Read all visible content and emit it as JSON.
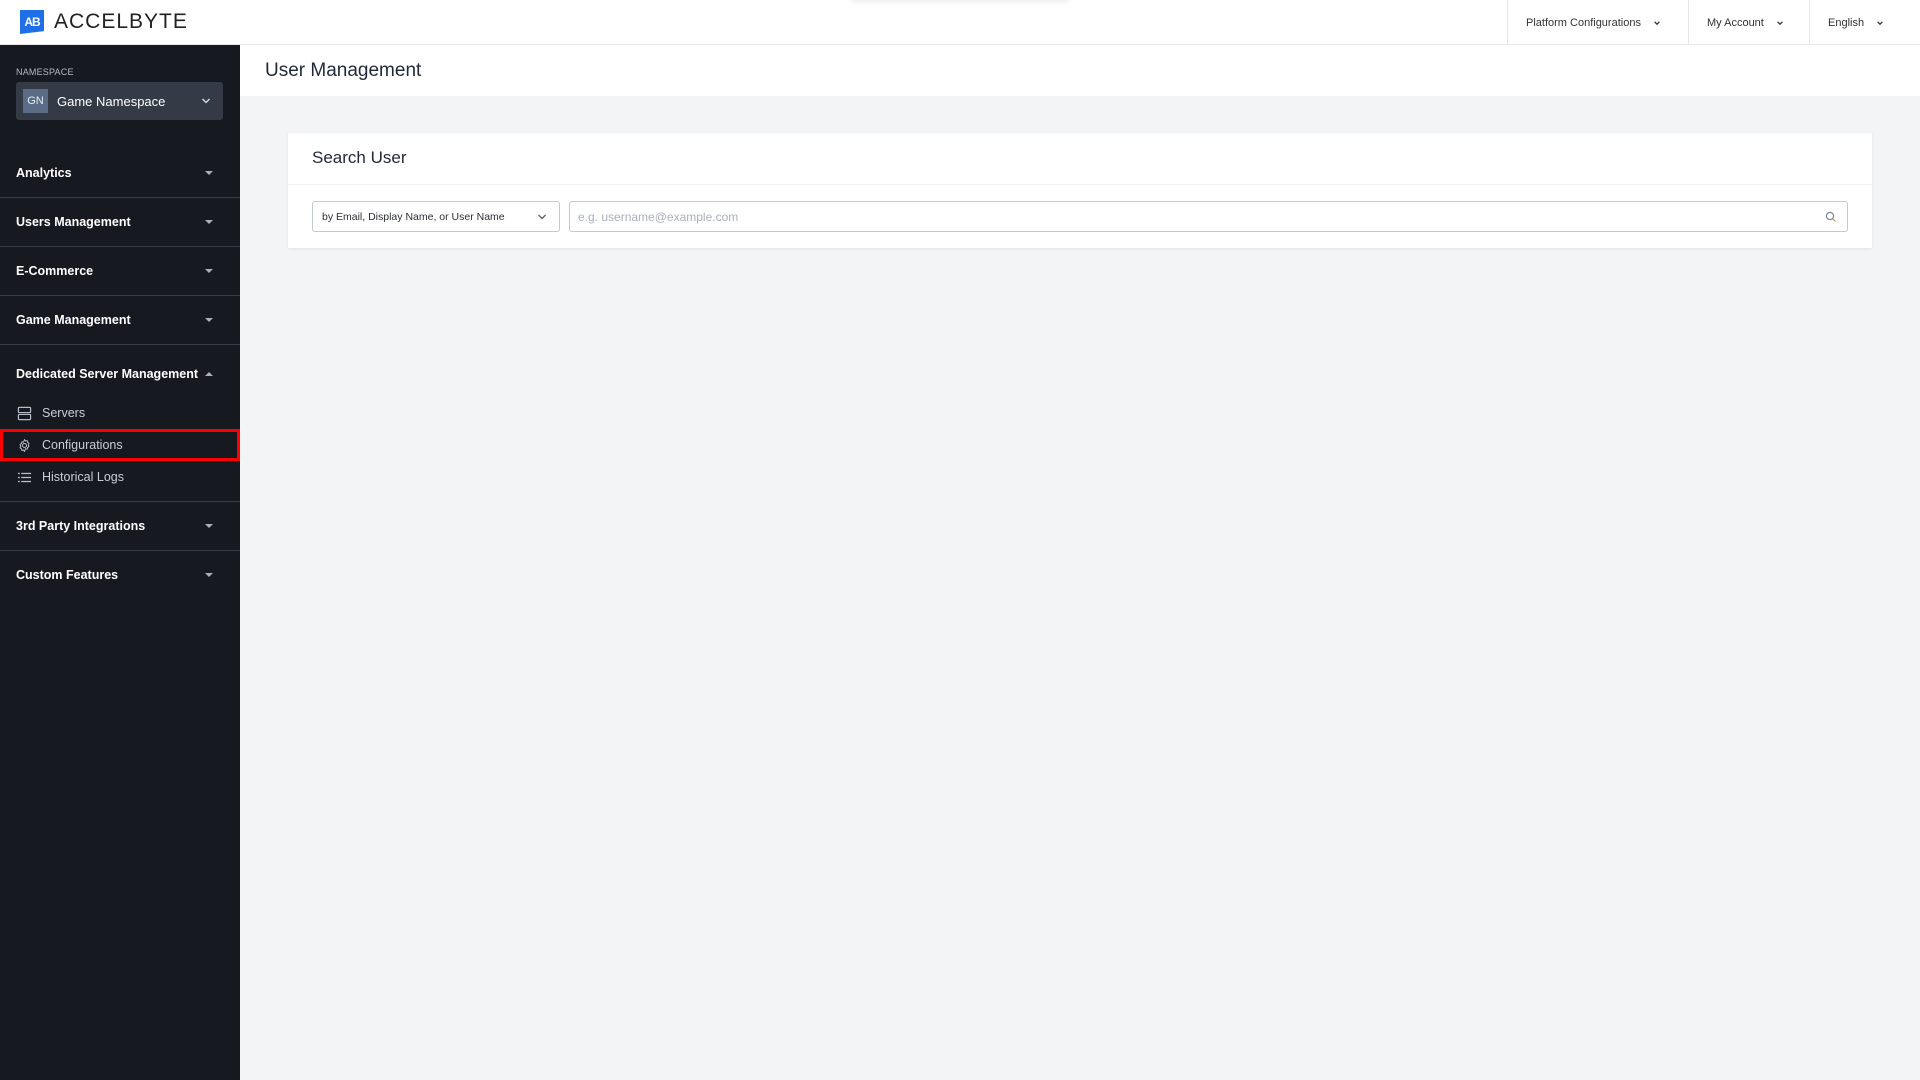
{
  "app": {
    "brand": "ACCELBYTE",
    "logo_mark": "AB",
    "accent_color": "#1e6fe8"
  },
  "topnav": {
    "items": [
      {
        "label": "Platform Configurations",
        "icon": "chevron-down-icon"
      },
      {
        "label": "My Account",
        "icon": "chevron-down-icon"
      },
      {
        "label": "English",
        "icon": "chevron-down-icon"
      }
    ]
  },
  "sidebar": {
    "namespace_label": "NAMESPACE",
    "namespace": {
      "badge": "GN",
      "name": "Game Namespace"
    },
    "sections": [
      {
        "label": "Analytics",
        "expanded": false
      },
      {
        "label": "Users Management",
        "expanded": false
      },
      {
        "label": "E-Commerce",
        "expanded": false
      },
      {
        "label": "Game Management",
        "expanded": false
      },
      {
        "label": "Dedicated Server Management",
        "expanded": true,
        "items": [
          {
            "label": "Servers",
            "icon": "server-icon"
          },
          {
            "label": "Configurations",
            "icon": "gear-icon",
            "highlighted": true
          },
          {
            "label": "Historical Logs",
            "icon": "list-icon"
          }
        ]
      },
      {
        "label": "3rd Party Integrations",
        "expanded": false
      },
      {
        "label": "Custom Features",
        "expanded": false
      }
    ],
    "highlight_color": "#ff0000"
  },
  "main": {
    "page_title": "User Management",
    "search_card": {
      "title": "Search User",
      "search_type": "by Email, Display Name, or User Name",
      "input_value": "",
      "input_placeholder": "e.g. username@example.com"
    }
  }
}
